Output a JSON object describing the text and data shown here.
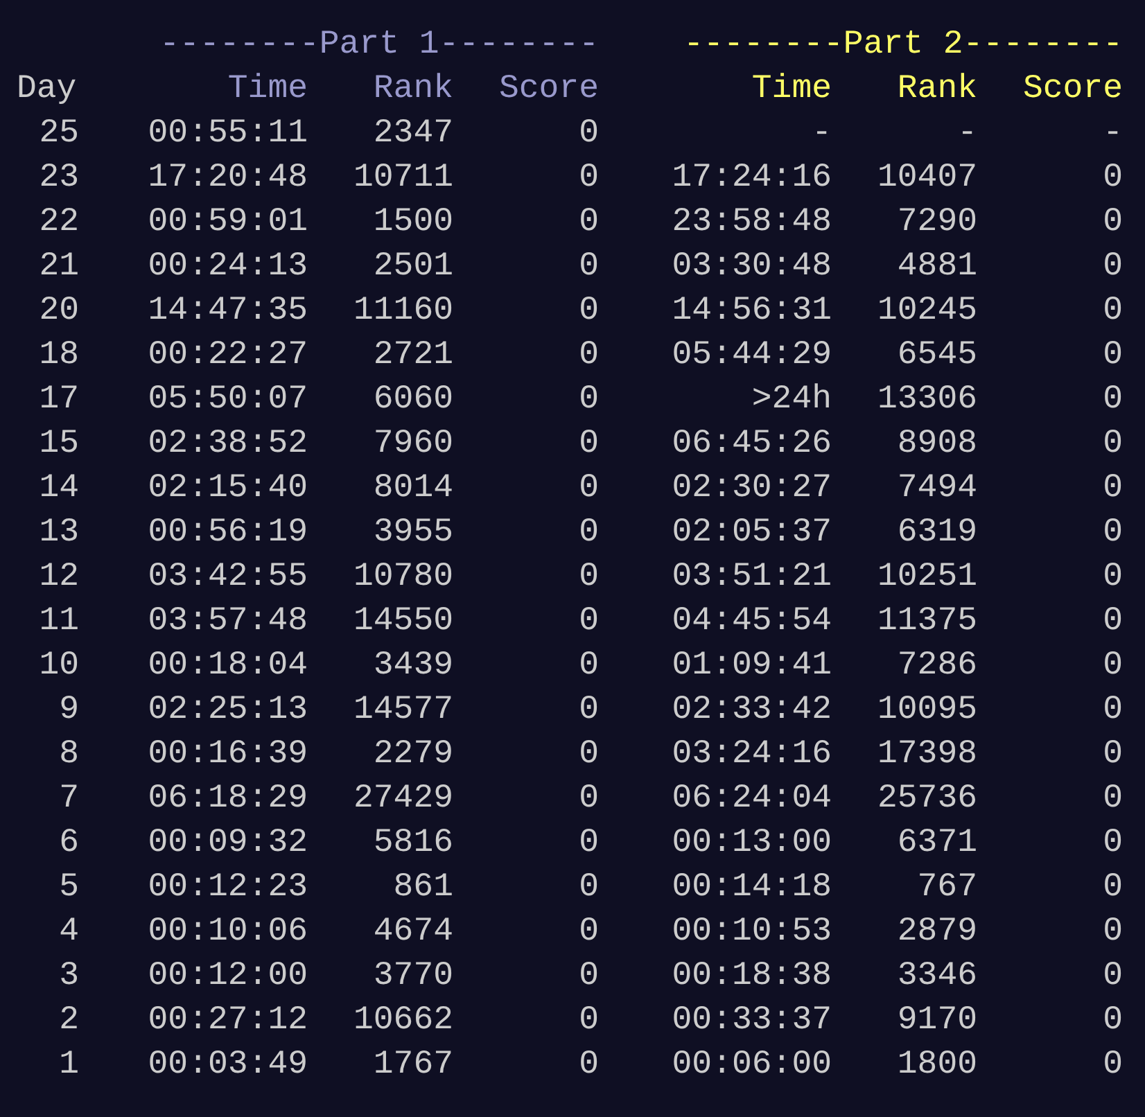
{
  "day_header": "Day",
  "parts": [
    {
      "title": "--------Part 1--------",
      "color": "#9999cc",
      "columns": [
        "Time",
        "Rank",
        "Score"
      ]
    },
    {
      "title": "--------Part 2--------",
      "color": "#ffff66",
      "columns": [
        "Time",
        "Rank",
        "Score"
      ]
    }
  ],
  "rows": [
    {
      "day": "25",
      "part1": [
        "00:55:11",
        "2347",
        "0"
      ],
      "part2": [
        "-",
        "-",
        "-"
      ]
    },
    {
      "day": "23",
      "part1": [
        "17:20:48",
        "10711",
        "0"
      ],
      "part2": [
        "17:24:16",
        "10407",
        "0"
      ]
    },
    {
      "day": "22",
      "part1": [
        "00:59:01",
        "1500",
        "0"
      ],
      "part2": [
        "23:58:48",
        "7290",
        "0"
      ]
    },
    {
      "day": "21",
      "part1": [
        "00:24:13",
        "2501",
        "0"
      ],
      "part2": [
        "03:30:48",
        "4881",
        "0"
      ]
    },
    {
      "day": "20",
      "part1": [
        "14:47:35",
        "11160",
        "0"
      ],
      "part2": [
        "14:56:31",
        "10245",
        "0"
      ]
    },
    {
      "day": "18",
      "part1": [
        "00:22:27",
        "2721",
        "0"
      ],
      "part2": [
        "05:44:29",
        "6545",
        "0"
      ]
    },
    {
      "day": "17",
      "part1": [
        "05:50:07",
        "6060",
        "0"
      ],
      "part2": [
        ">24h",
        "13306",
        "0"
      ]
    },
    {
      "day": "15",
      "part1": [
        "02:38:52",
        "7960",
        "0"
      ],
      "part2": [
        "06:45:26",
        "8908",
        "0"
      ]
    },
    {
      "day": "14",
      "part1": [
        "02:15:40",
        "8014",
        "0"
      ],
      "part2": [
        "02:30:27",
        "7494",
        "0"
      ]
    },
    {
      "day": "13",
      "part1": [
        "00:56:19",
        "3955",
        "0"
      ],
      "part2": [
        "02:05:37",
        "6319",
        "0"
      ]
    },
    {
      "day": "12",
      "part1": [
        "03:42:55",
        "10780",
        "0"
      ],
      "part2": [
        "03:51:21",
        "10251",
        "0"
      ]
    },
    {
      "day": "11",
      "part1": [
        "03:57:48",
        "14550",
        "0"
      ],
      "part2": [
        "04:45:54",
        "11375",
        "0"
      ]
    },
    {
      "day": "10",
      "part1": [
        "00:18:04",
        "3439",
        "0"
      ],
      "part2": [
        "01:09:41",
        "7286",
        "0"
      ]
    },
    {
      "day": "9",
      "part1": [
        "02:25:13",
        "14577",
        "0"
      ],
      "part2": [
        "02:33:42",
        "10095",
        "0"
      ]
    },
    {
      "day": "8",
      "part1": [
        "00:16:39",
        "2279",
        "0"
      ],
      "part2": [
        "03:24:16",
        "17398",
        "0"
      ]
    },
    {
      "day": "7",
      "part1": [
        "06:18:29",
        "27429",
        "0"
      ],
      "part2": [
        "06:24:04",
        "25736",
        "0"
      ]
    },
    {
      "day": "6",
      "part1": [
        "00:09:32",
        "5816",
        "0"
      ],
      "part2": [
        "00:13:00",
        "6371",
        "0"
      ]
    },
    {
      "day": "5",
      "part1": [
        "00:12:23",
        "861",
        "0"
      ],
      "part2": [
        "00:14:18",
        "767",
        "0"
      ]
    },
    {
      "day": "4",
      "part1": [
        "00:10:06",
        "4674",
        "0"
      ],
      "part2": [
        "00:10:53",
        "2879",
        "0"
      ]
    },
    {
      "day": "3",
      "part1": [
        "00:12:00",
        "3770",
        "0"
      ],
      "part2": [
        "00:18:38",
        "3346",
        "0"
      ]
    },
    {
      "day": "2",
      "part1": [
        "00:27:12",
        "10662",
        "0"
      ],
      "part2": [
        "00:33:37",
        "9170",
        "0"
      ]
    },
    {
      "day": "1",
      "part1": [
        "00:03:49",
        "1767",
        "0"
      ],
      "part2": [
        "00:06:00",
        "1800",
        "0"
      ]
    }
  ]
}
